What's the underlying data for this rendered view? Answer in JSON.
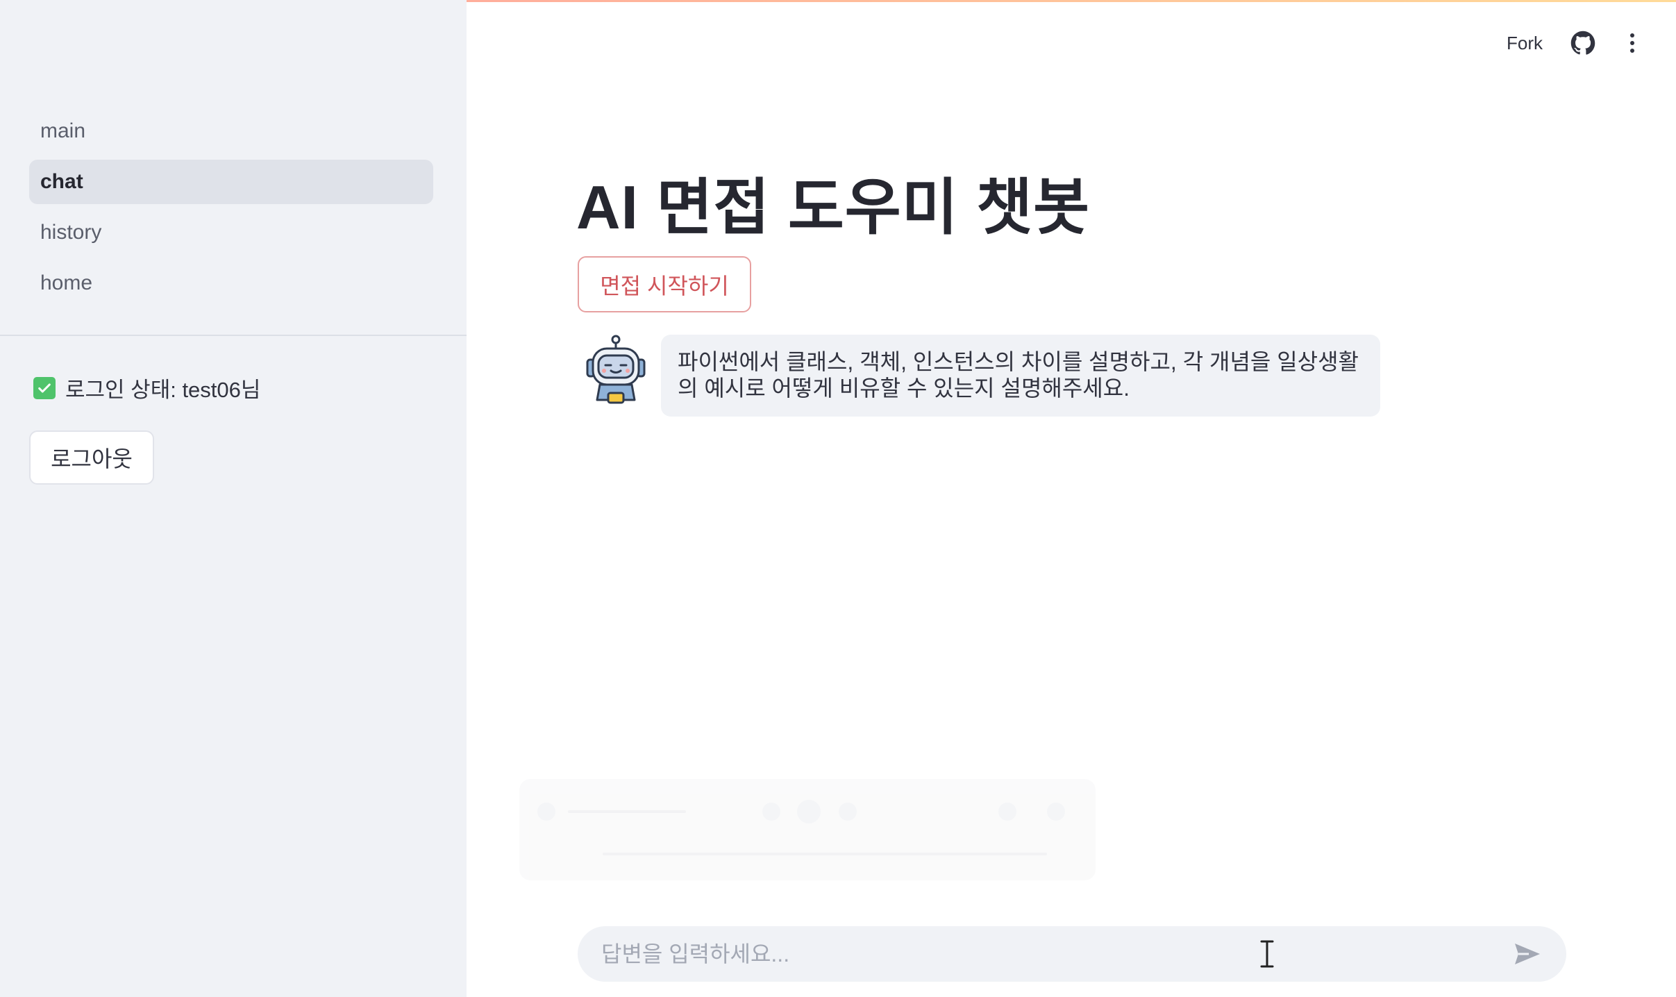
{
  "sidebar": {
    "nav_items": [
      {
        "label": "main"
      },
      {
        "label": "chat",
        "active": true
      },
      {
        "label": "history"
      },
      {
        "label": "home"
      }
    ],
    "login_status": "로그인 상태: test06님",
    "logout_label": "로그아웃"
  },
  "header": {
    "fork_label": "Fork"
  },
  "main": {
    "title": "AI 면접 도우미 챗봇",
    "start_button_label": "면접 시작하기",
    "messages": [
      {
        "role": "assistant",
        "avatar": "robot-icon",
        "text": "파이썬에서 클래스, 객체, 인스턴스의 차이를 설명하고, 각 개념을 일상생활의 예시로 어떻게 비유할 수 있는지 설명해주세요."
      }
    ]
  },
  "chat_input": {
    "placeholder": "답변을 입력하세요...",
    "value": ""
  },
  "colors": {
    "sidebar_bg": "#f0f2f6",
    "accent_red": "#d0555a",
    "checkbox_green": "#4fc36b"
  }
}
